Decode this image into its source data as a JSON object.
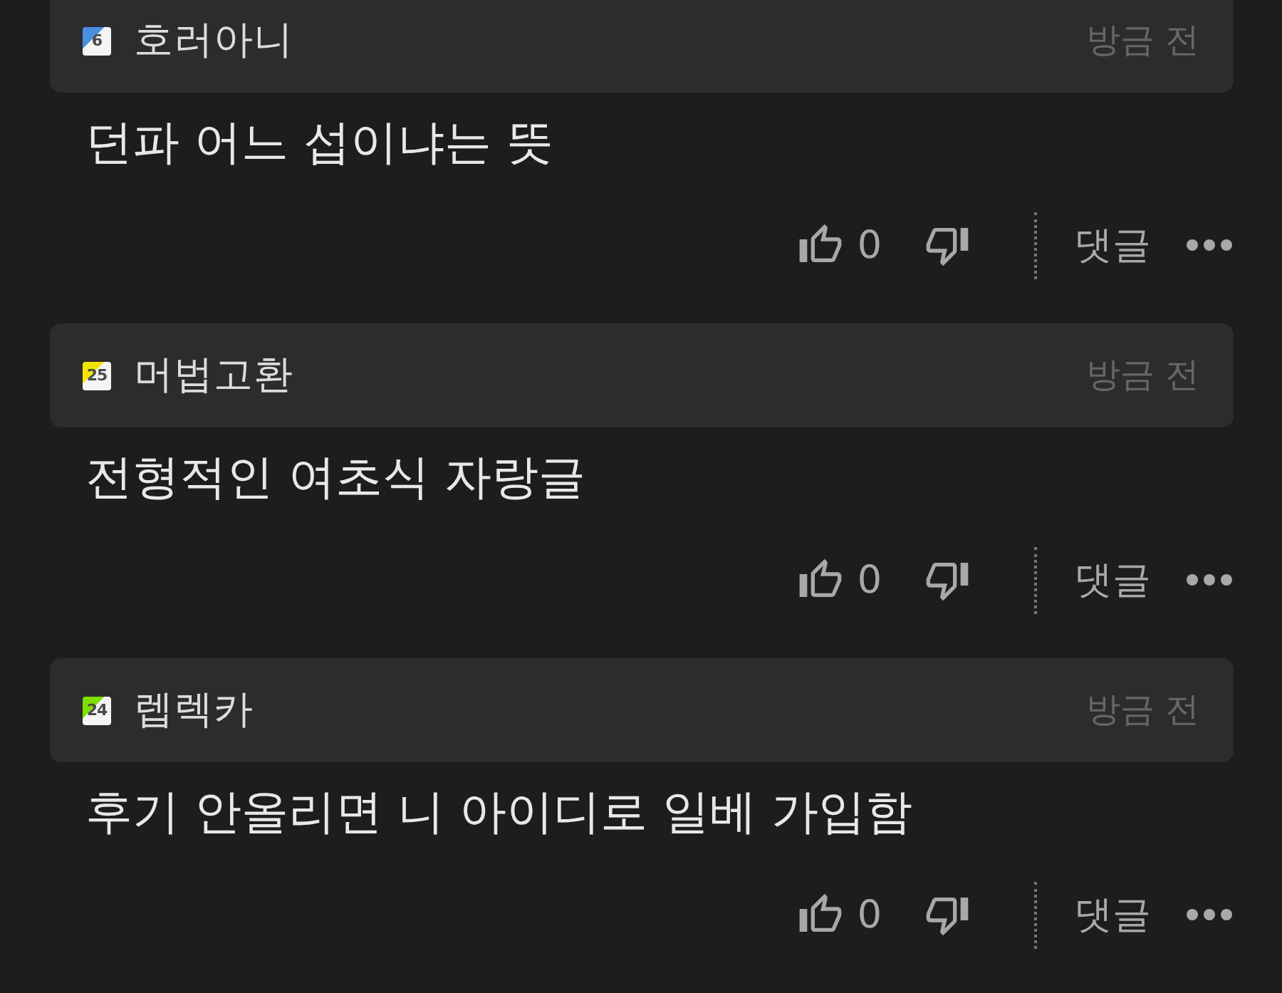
{
  "comments": [
    {
      "author": "호러아니",
      "badge": {
        "text": "6",
        "color": "#4a8fe0"
      },
      "time": "방금 전",
      "text": "던파 어느 섭이냐는 뜻",
      "likes": "0",
      "reply_label": "댓글"
    },
    {
      "author": "머법고환",
      "badge": {
        "text": "25",
        "color": "#f2e600"
      },
      "time": "방금 전",
      "text": "전형적인 여초식 자랑글",
      "likes": "0",
      "reply_label": "댓글"
    },
    {
      "author": "렙렉카",
      "badge": {
        "text": "24",
        "color": "#7ee000"
      },
      "time": "방금 전",
      "text": "후기 안올리면 니 아이디로 일베 가입함",
      "likes": "0",
      "reply_label": "댓글"
    }
  ]
}
